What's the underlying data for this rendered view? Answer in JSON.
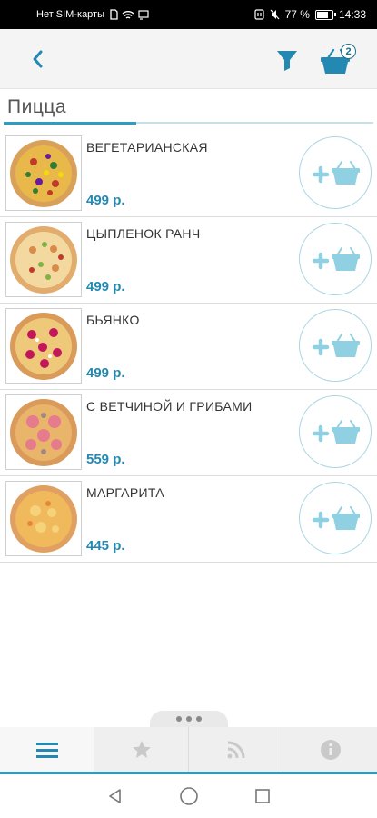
{
  "status_bar": {
    "carrier": "Нет SIM-карты",
    "battery": "77 %",
    "battery_level": 0.77,
    "time": "14:33"
  },
  "header": {
    "back_icon": "chevron-left-icon",
    "filter_icon": "funnel-icon",
    "cart_icon": "basket-icon",
    "cart_count": "2",
    "accent_color": "#2389b3"
  },
  "category": {
    "title": "Пицца"
  },
  "products": [
    {
      "name": "ВЕГЕТАРИАНСКАЯ",
      "price": "499 р."
    },
    {
      "name": "ЦЫПЛЕНОК РАНЧ",
      "price": "499 р."
    },
    {
      "name": "БЬЯНКО",
      "price": "499 р."
    },
    {
      "name": "С ВЕТЧИНОЙ И ГРИБАМИ",
      "price": "559 р."
    },
    {
      "name": "МАРГАРИТА",
      "price": "445 р."
    }
  ],
  "tabs": [
    {
      "icon": "menu-icon",
      "active": true
    },
    {
      "icon": "star-icon",
      "active": false
    },
    {
      "icon": "rss-icon",
      "active": false
    },
    {
      "icon": "info-icon",
      "active": false
    }
  ],
  "nav": {
    "back_icon": "nav-back-icon",
    "home_icon": "nav-home-icon",
    "recents_icon": "nav-recents-icon"
  }
}
